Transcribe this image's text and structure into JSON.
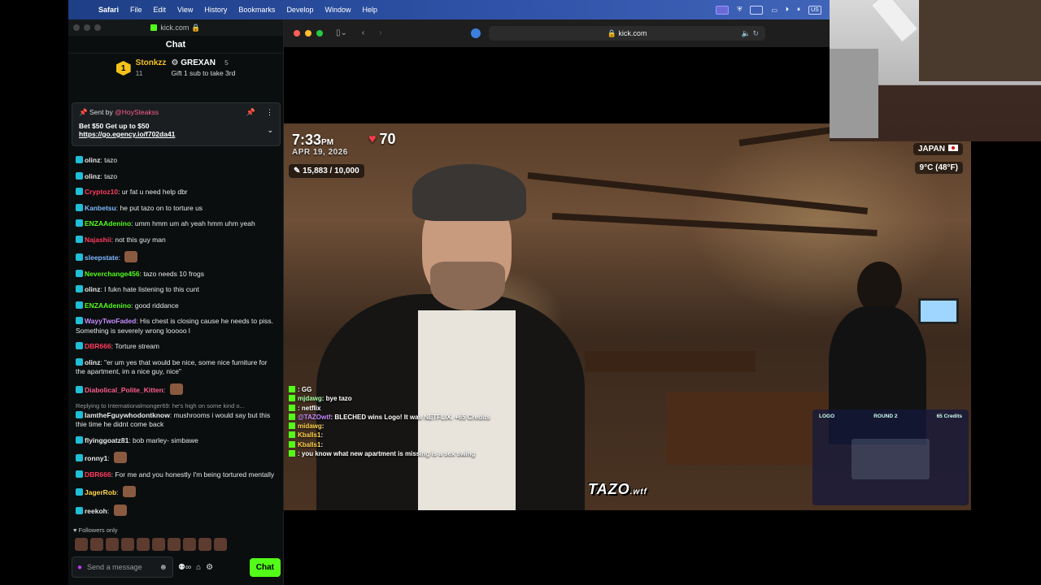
{
  "menubar": {
    "app": "Safari",
    "items": [
      "File",
      "Edit",
      "View",
      "History",
      "Bookmarks",
      "Develop",
      "Window",
      "Help"
    ],
    "keyboard_layout": "US"
  },
  "chat_window": {
    "domain": "kick.com",
    "header": "Chat",
    "leaderboard": {
      "rank": "1",
      "first_user": "Stonkzz",
      "first_count": "11",
      "second_user": "GREXAN",
      "second_count": "5",
      "gift_hint": "Gift 1 sub to take 3rd"
    },
    "pinned": {
      "sent_by_label": "Sent by",
      "sender": "@HoySteakss",
      "message": "Bet $50 Get up to $50",
      "link": "https://go.egency.io/f702da41"
    },
    "messages": [
      {
        "user": "olinz",
        "text": "tazo",
        "color": "#e8e8e8"
      },
      {
        "user": "olinz",
        "text": "tazo",
        "color": "#e8e8e8"
      },
      {
        "user": "Cryptoz10",
        "text": "ur fat u need help dbr",
        "color": "#ff3b5c"
      },
      {
        "user": "Kanbetsu",
        "text": "he put tazo on to torture us",
        "color": "#7fb9ff"
      },
      {
        "user": "ENZAAdenino",
        "text": "umm hmm um ah yeah hmm uhm yeah",
        "color": "#53fc18"
      },
      {
        "user": "Najashii",
        "text": "not this guy man",
        "color": "#ff3b5c"
      },
      {
        "user": "sleepstate",
        "text": "",
        "color": "#7fb9ff"
      },
      {
        "user": "Neverchange456",
        "text": "tazo needs 10 frogs",
        "color": "#53fc18"
      },
      {
        "user": "olinz",
        "text": "I fukn hate listening to this cunt",
        "color": "#e8e8e8"
      },
      {
        "user": "ENZAAdenino",
        "text": "good riddance",
        "color": "#53fc18"
      },
      {
        "user": "WayyTwoFaded",
        "text": "His chest is closing cause he needs to piss. Something is severely wrong looooo l",
        "color": "#c58cff"
      },
      {
        "user": "DBR666",
        "text": "Torture stream",
        "color": "#ff3b5c"
      },
      {
        "user": "olinz",
        "text": "\"er um yes that would be nice, some nice furniture for the apartment, im a nice guy, nice\"",
        "color": "#e8e8e8"
      },
      {
        "user": "Diabolical_Polite_Kitten",
        "text": "",
        "color": "#ff5c8a"
      },
      {
        "reply": "Replying to Internationalmonger69: he's high on some kind o...",
        "user": "IamtheFguywhodontknow",
        "text": "mushrooms i would say but this thie time he didnt come back",
        "color": "#e8e8e8"
      },
      {
        "user": "flyinggoatz81",
        "text": "bob marley- simbawe",
        "color": "#e8e8e8"
      },
      {
        "user": "ronny1",
        "text": "",
        "color": "#e8e8e8"
      },
      {
        "user": "DBR666",
        "text": "For me and you honestly I'm being tortured mentally",
        "color": "#ff3b5c"
      },
      {
        "user": "JagerRob",
        "text": "",
        "color": "#ffd54a"
      },
      {
        "user": "reekoh",
        "text": "",
        "color": "#e8e8e8"
      }
    ],
    "followers_only": "Followers only",
    "input_placeholder": "Send a message",
    "chat_button": "Chat"
  },
  "browser": {
    "url": "kick.com"
  },
  "stream_overlay": {
    "time": "7:33",
    "ampm": "PM",
    "date": "APR 19, 2026",
    "heart_rate": "70",
    "goal": "15,883 / 10,000",
    "location": "JAPAN",
    "temperature": "9°C (48°F)",
    "watermark": "TAZO",
    "watermark_suffix": ".wtf",
    "game_panel": {
      "left": "LOGO",
      "middle": "ROUND 2",
      "right": "65 Credits"
    },
    "chat": [
      {
        "user": "",
        "text": "GG"
      },
      {
        "user": "mjdawg",
        "text": "bye tazo"
      },
      {
        "user": "",
        "text": "netflix"
      },
      {
        "user": "@TAZOwtf",
        "text": "BLECHED wins Logo! It was NETFLIX. +65 Credits"
      },
      {
        "user": "midawg",
        "text": ""
      },
      {
        "user": "Kballs1",
        "text": ""
      },
      {
        "user": "Kballs1",
        "text": ""
      },
      {
        "user": "",
        "text": "you know what new apartment is missing is a sex swing"
      }
    ]
  }
}
